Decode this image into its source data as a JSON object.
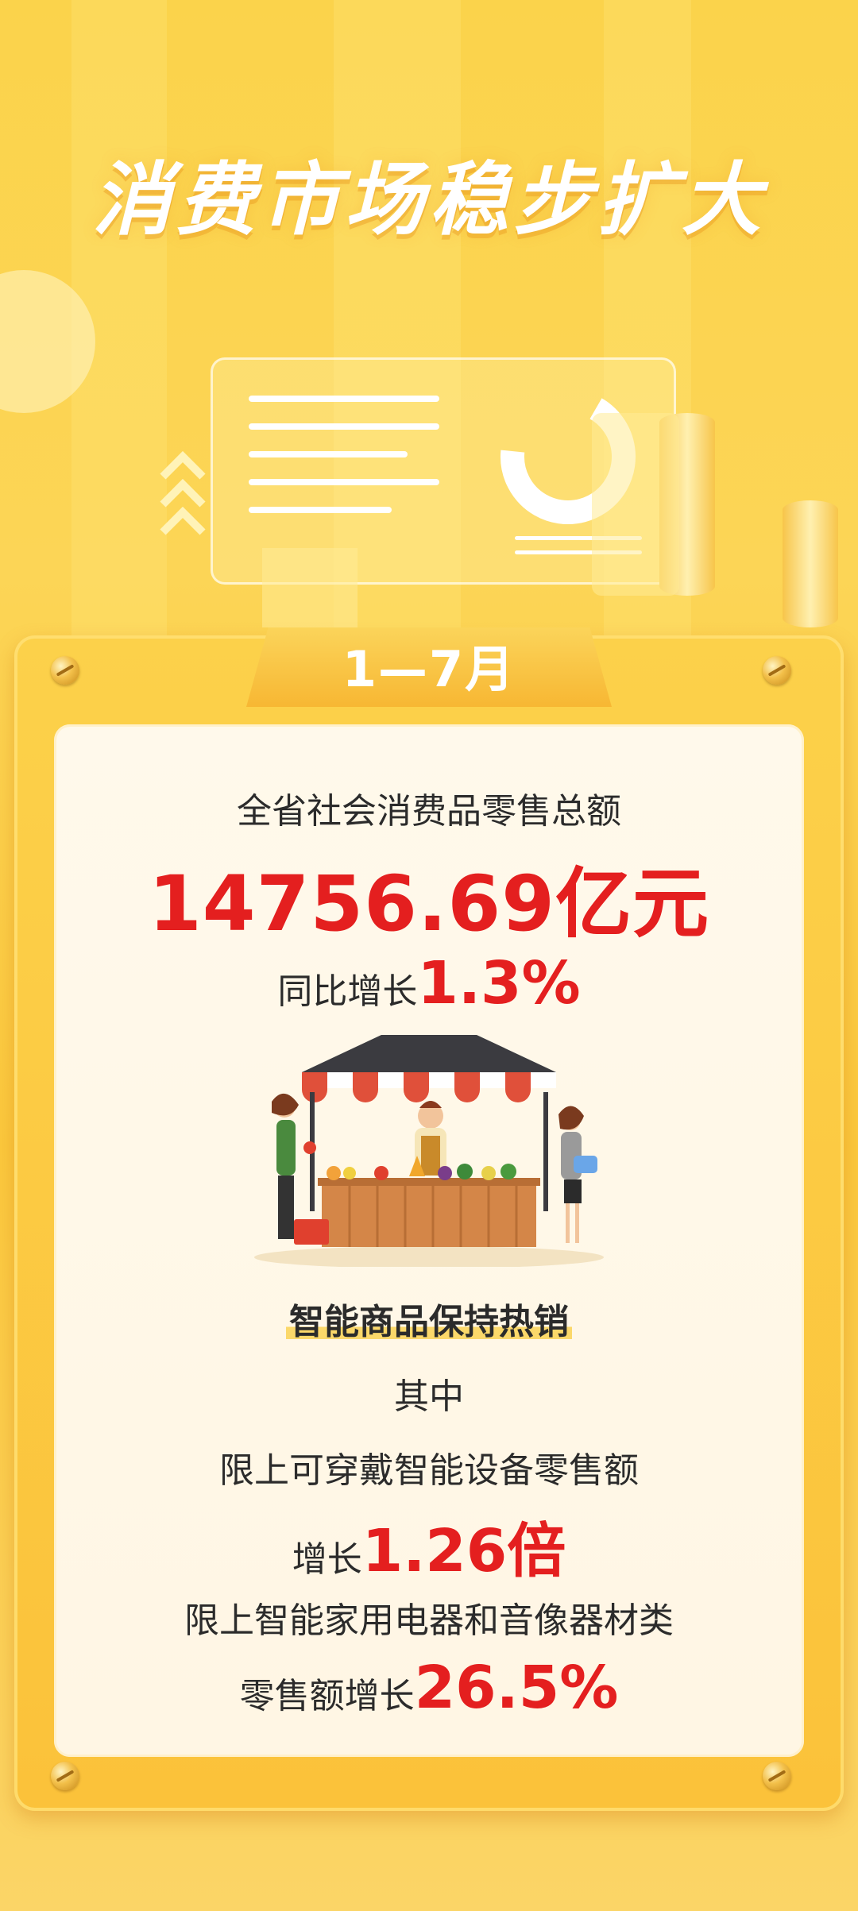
{
  "hero": {
    "title": "消费市场稳步扩大"
  },
  "card": {
    "period_label": "1—7月",
    "headline_label": "全省社会消费品零售总额",
    "headline_value": "14756.69亿元",
    "growth_prefix": "同比增长",
    "growth_value": "1.3%",
    "section_title": "智能商品保持热销",
    "qizhong": "其中",
    "wearables_label": "限上可穿戴智能设备零售额",
    "wearables_prefix": "增长",
    "wearables_value": "1.26倍",
    "appliances_label": "限上智能家用电器和音像器材类",
    "appliances_prefix": "零售额增长",
    "appliances_value": "26.5%"
  },
  "colors": {
    "accent_red": "#e41f1f",
    "brand_yellow": "#fbc23a",
    "text_dark": "#2b2b2b"
  },
  "icons": [
    "market-stall-illustration",
    "donut-chart-icon",
    "chevron-up-icon"
  ]
}
